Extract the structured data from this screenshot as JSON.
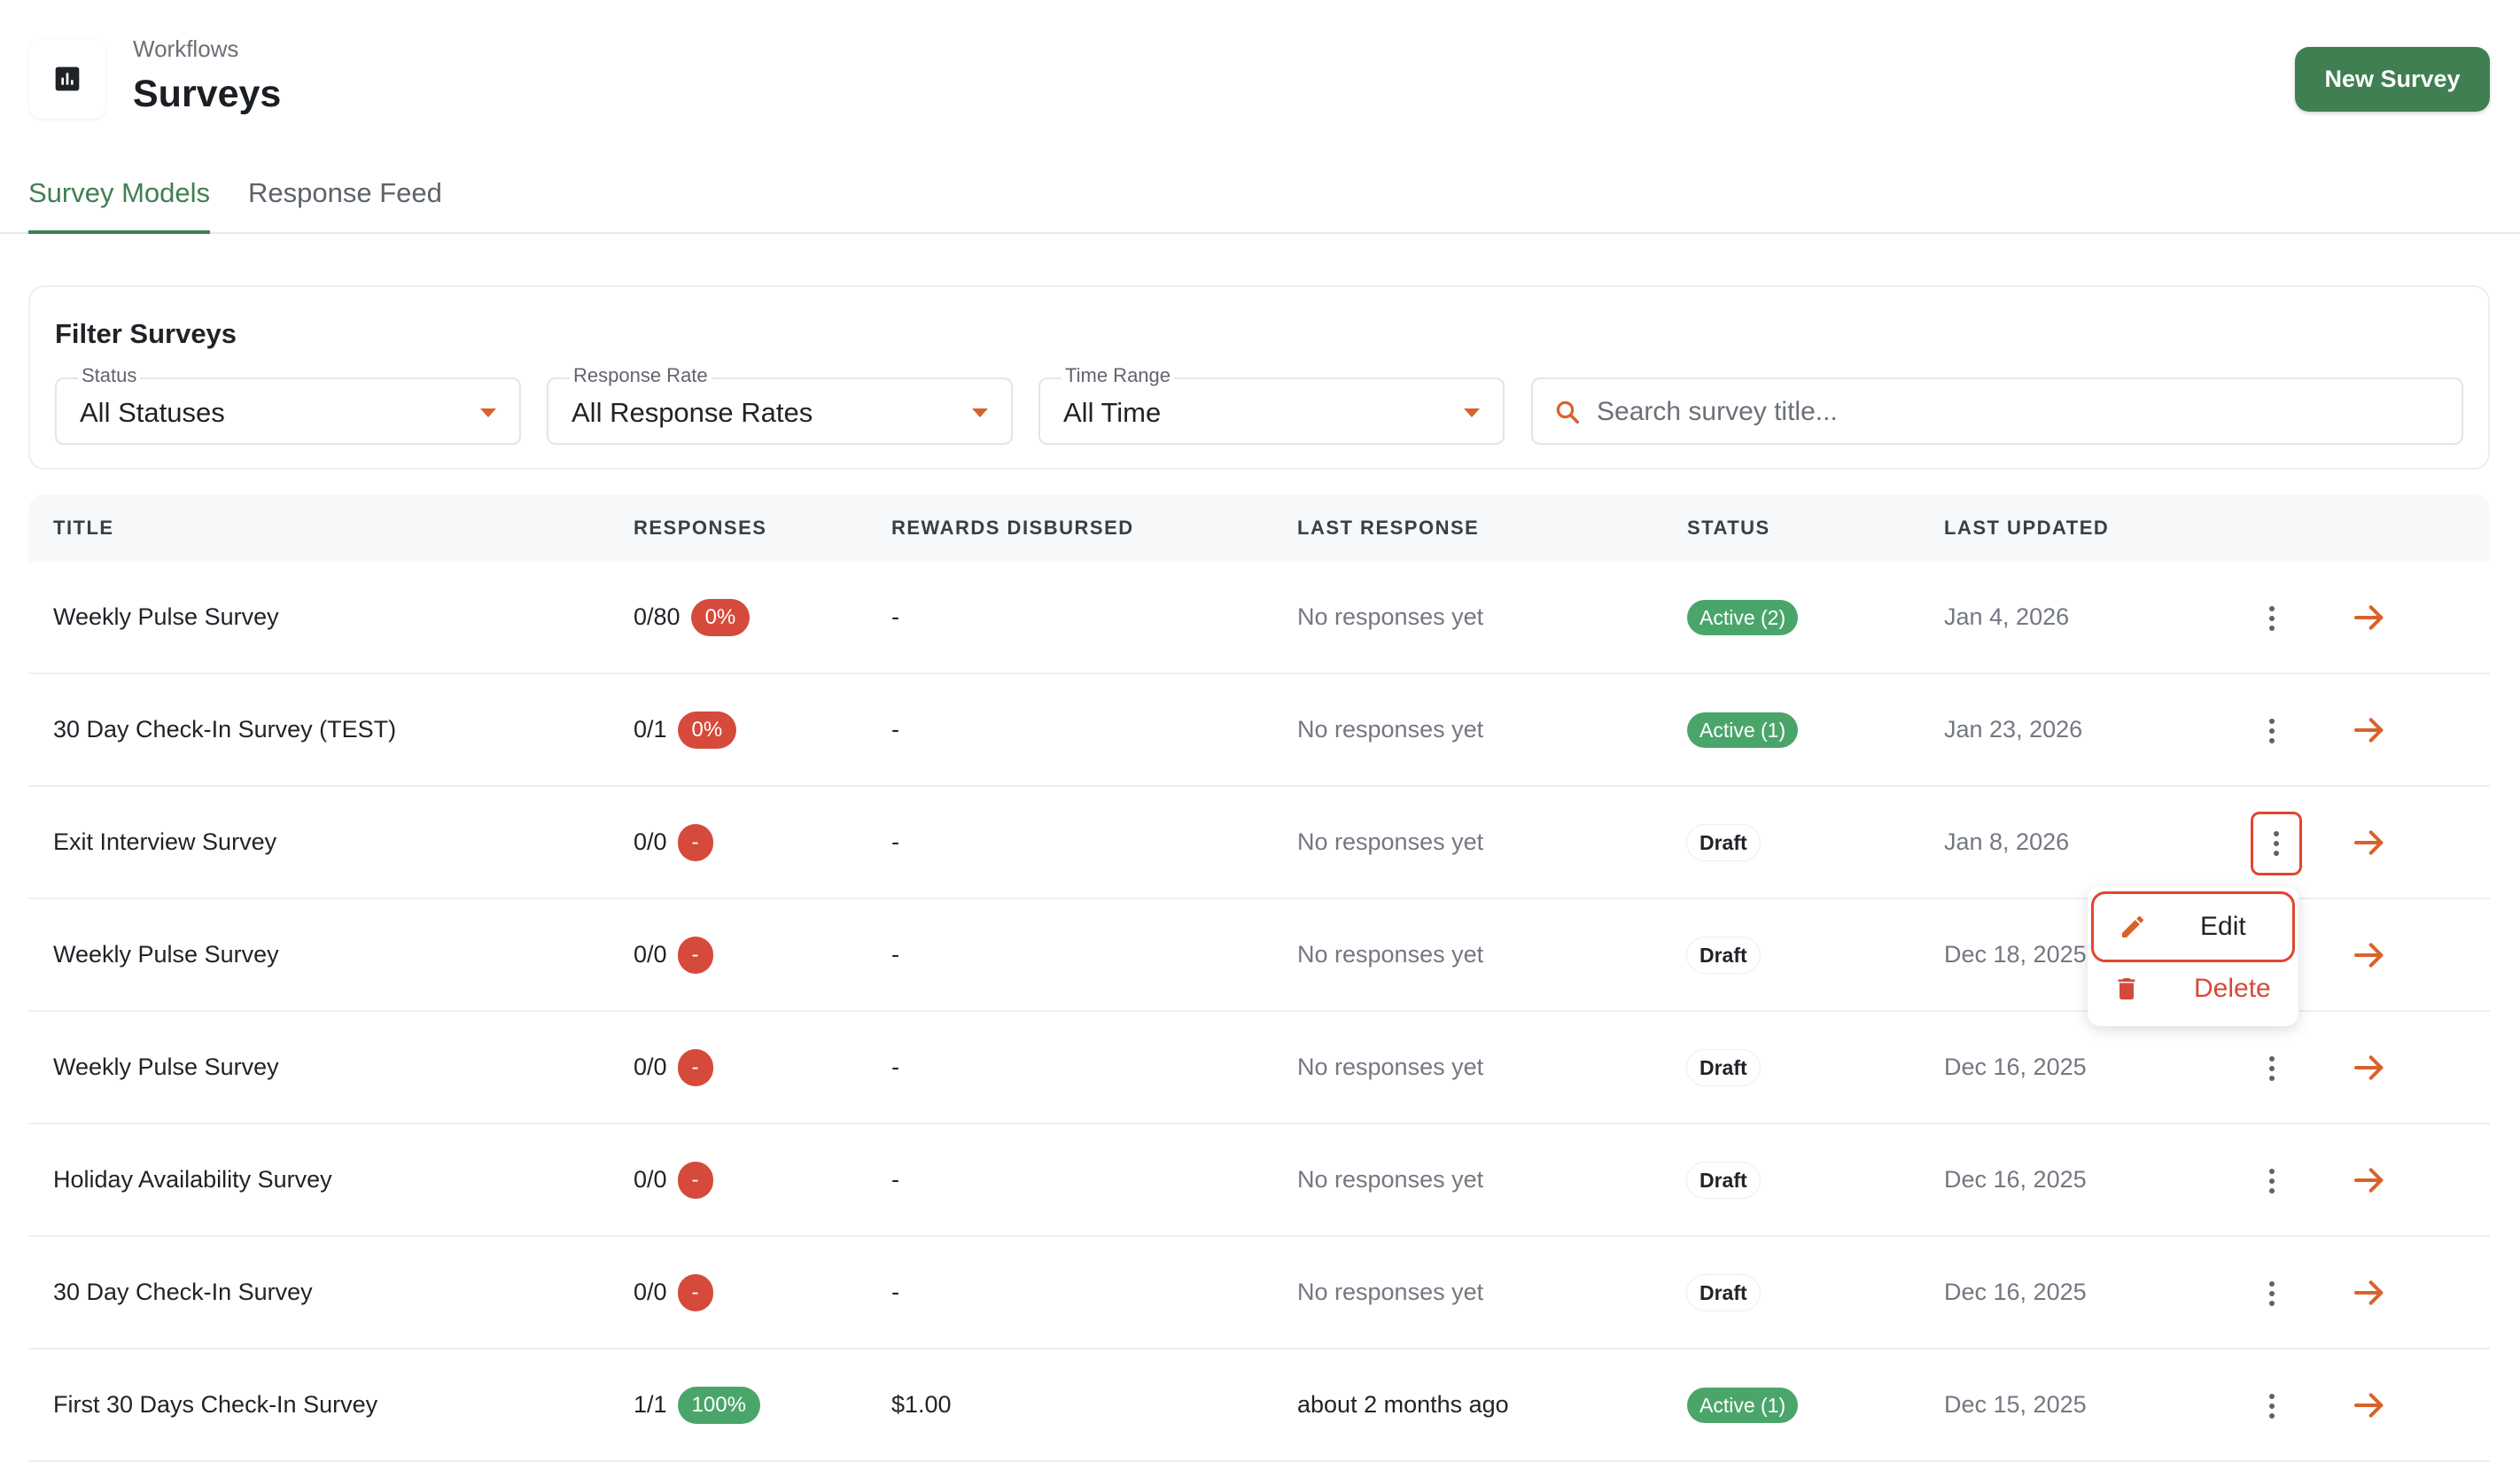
{
  "header": {
    "breadcrumb": "Workflows",
    "title": "Surveys",
    "new_button": "New Survey"
  },
  "tabs": [
    {
      "label": "Survey Models",
      "active": true
    },
    {
      "label": "Response Feed",
      "active": false
    }
  ],
  "filters": {
    "title": "Filter Surveys",
    "status": {
      "label": "Status",
      "value": "All Statuses"
    },
    "response_rate": {
      "label": "Response Rate",
      "value": "All Response Rates"
    },
    "time_range": {
      "label": "Time Range",
      "value": "All Time"
    },
    "search": {
      "placeholder": "Search survey title...",
      "value": ""
    }
  },
  "table": {
    "columns": [
      "TITLE",
      "RESPONSES",
      "REWARDS DISBURSED",
      "LAST RESPONSE",
      "STATUS",
      "LAST UPDATED"
    ],
    "rows": [
      {
        "title": "Weekly Pulse Survey",
        "responses": "0/80",
        "rate": "0%",
        "rate_color": "red",
        "rewards": "-",
        "last_response": "No responses yet",
        "status": "Active (2)",
        "status_type": "active",
        "updated": "Jan 4, 2026"
      },
      {
        "title": "30 Day Check-In Survey (TEST)",
        "responses": "0/1",
        "rate": "0%",
        "rate_color": "red",
        "rewards": "-",
        "last_response": "No responses yet",
        "status": "Active (1)",
        "status_type": "active",
        "updated": "Jan 23, 2026"
      },
      {
        "title": "Exit Interview Survey",
        "responses": "0/0",
        "rate": "-",
        "rate_color": "red",
        "rewards": "-",
        "last_response": "No responses yet",
        "status": "Draft",
        "status_type": "draft",
        "updated": "Jan 8, 2026"
      },
      {
        "title": "Weekly Pulse Survey",
        "responses": "0/0",
        "rate": "-",
        "rate_color": "red",
        "rewards": "-",
        "last_response": "No responses yet",
        "status": "Draft",
        "status_type": "draft",
        "updated": "Dec 18, 2025"
      },
      {
        "title": "Weekly Pulse Survey",
        "responses": "0/0",
        "rate": "-",
        "rate_color": "red",
        "rewards": "-",
        "last_response": "No responses yet",
        "status": "Draft",
        "status_type": "draft",
        "updated": "Dec 16, 2025"
      },
      {
        "title": "Holiday Availability Survey",
        "responses": "0/0",
        "rate": "-",
        "rate_color": "red",
        "rewards": "-",
        "last_response": "No responses yet",
        "status": "Draft",
        "status_type": "draft",
        "updated": "Dec 16, 2025"
      },
      {
        "title": "30 Day Check-In Survey",
        "responses": "0/0",
        "rate": "-",
        "rate_color": "red",
        "rewards": "-",
        "last_response": "No responses yet",
        "status": "Draft",
        "status_type": "draft",
        "updated": "Dec 16, 2025"
      },
      {
        "title": "First 30 Days Check-In Survey",
        "responses": "1/1",
        "rate": "100%",
        "rate_color": "green",
        "rewards": "$1.00",
        "last_response": "about 2 months ago",
        "status": "Active (1)",
        "status_type": "active",
        "updated": "Dec 15, 2025"
      }
    ]
  },
  "row_menu": {
    "edit": "Edit",
    "delete": "Delete"
  },
  "colors": {
    "brand_green": "#3f7f52",
    "accent_orange": "#d9622b",
    "danger_red": "#d64a3b",
    "success_green": "#4aa56b"
  },
  "icons": {
    "page": "bar-chart-icon",
    "search": "search-icon",
    "row_actions": "kebab-icon",
    "row_open": "arrow-right-icon",
    "edit": "pencil-icon",
    "delete": "trash-icon"
  }
}
